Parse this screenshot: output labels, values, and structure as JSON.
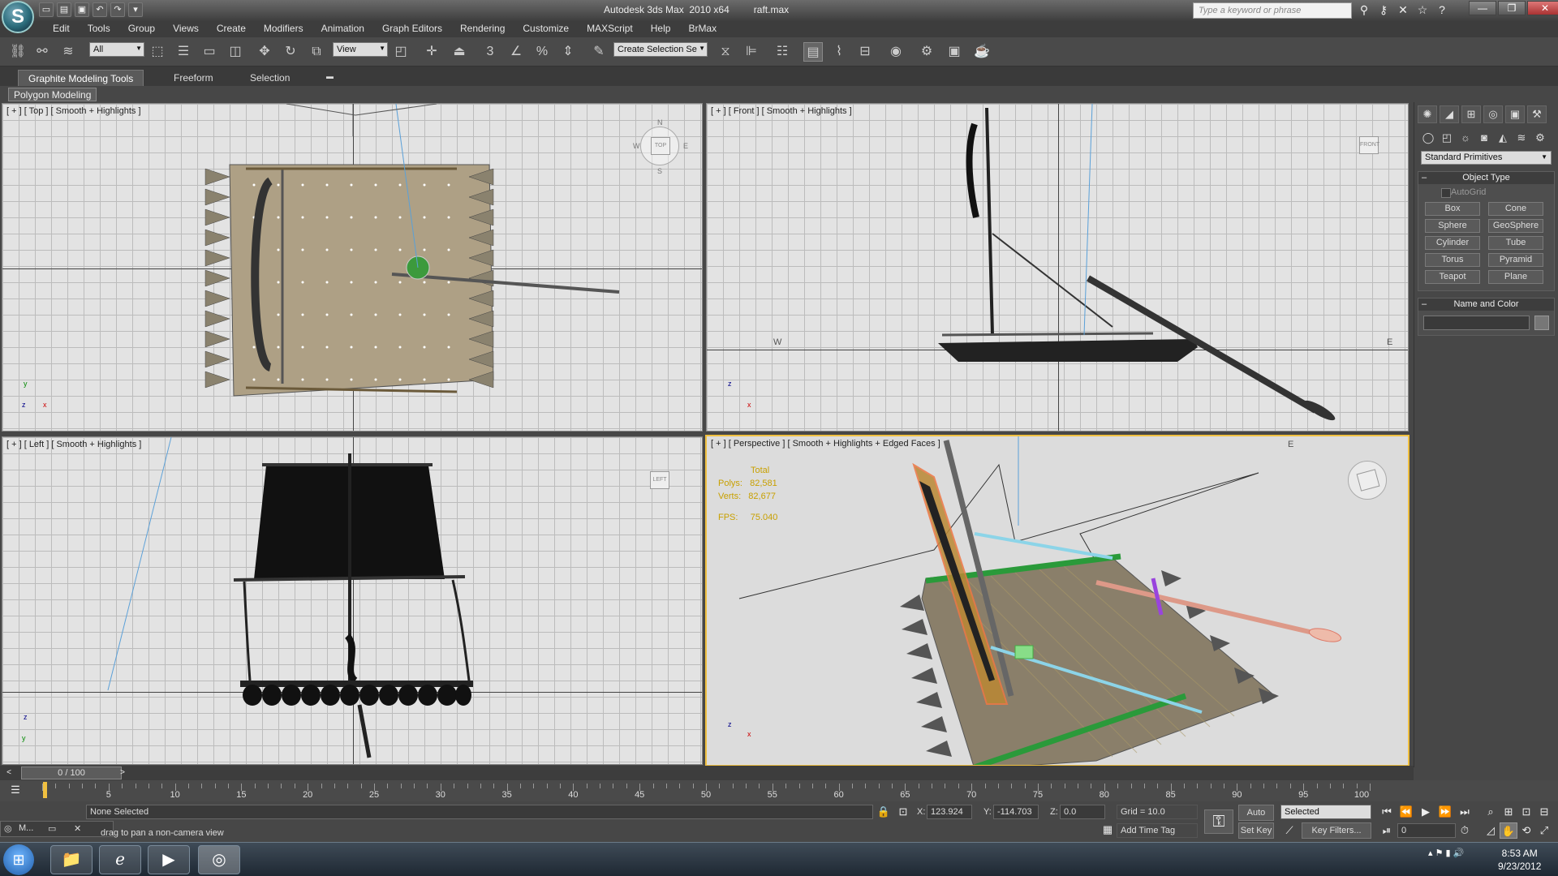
{
  "window": {
    "logo": "S",
    "title": "Autodesk 3ds Max  2010 x64         raft.max",
    "search_placeholder": "Type a keyword or phrase",
    "controls": [
      "—",
      "❐",
      "✕"
    ]
  },
  "menu": [
    "Edit",
    "Tools",
    "Group",
    "Views",
    "Create",
    "Modifiers",
    "Animation",
    "Graph Editors",
    "Rendering",
    "Customize",
    "MAXScript",
    "Help",
    "BrMax"
  ],
  "toolbar": {
    "selection_filter": "All",
    "ref_coord": "View",
    "named_selection": "Create Selection Se",
    "snap_label": "3"
  },
  "ribbon": {
    "tabs": [
      "Graphite Modeling Tools",
      "Freeform",
      "Selection"
    ],
    "panel_label": "Polygon Modeling"
  },
  "viewports": {
    "top": {
      "label": "[ + ] [ Top ] [ Smooth + Highlights ]",
      "cube_face": "TOP",
      "dirs": [
        "N",
        "S",
        "W",
        "E"
      ]
    },
    "front": {
      "label": "[ + ] [ Front ] [ Smooth + Highlights ]",
      "cube_face": "FRONT",
      "markers": [
        "W",
        "E"
      ]
    },
    "left": {
      "label": "[ + ] [ Left ] [ Smooth + Highlights ]",
      "cube_face": "LEFT"
    },
    "perspective": {
      "label": "[ + ] [ Perspective ] [ Smooth + Highlights + Edged Faces ]",
      "stats": {
        "total": "Total",
        "polys": "Polys:   82,581",
        "verts": "Verts:   82,677",
        "fps": "FPS:     75.040"
      },
      "marker": "E"
    }
  },
  "axes": {
    "x": "x",
    "y": "y",
    "z": "z"
  },
  "command_panel": {
    "dropdown": "Standard Primitives",
    "object_type_title": "Object Type",
    "autogrid": "AutoGrid",
    "object_buttons": [
      "Box",
      "Cone",
      "Sphere",
      "GeoSphere",
      "Cylinder",
      "Tube",
      "Torus",
      "Pyramid",
      "Teapot",
      "Plane"
    ],
    "name_color_title": "Name and Color"
  },
  "timeline": {
    "slider": "0 / 100",
    "ticks": [
      "5",
      "10",
      "15",
      "20",
      "25",
      "30",
      "35",
      "40",
      "45",
      "50",
      "55",
      "60",
      "65",
      "70",
      "75",
      "80",
      "85",
      "90",
      "95",
      "100"
    ],
    "current_frame": 0
  },
  "status": {
    "selection": "None Selected",
    "hint": "Click or click-and-drag to pan a non-camera view",
    "hint_visible": "drag to pan a non-camera view",
    "x_label": "X:",
    "x_value": "123.924",
    "y_label": "Y:",
    "y_value": "-114.703",
    "z_label": "Z:",
    "z_value": "0.0",
    "grid": "Grid = 10.0",
    "add_time_tag": "Add Time Tag",
    "auto_key": "Auto Key",
    "set_key": "Set Key",
    "key_mode": "Selected",
    "key_filters": "Key Filters...",
    "frame": "0",
    "mini": "M..."
  },
  "taskbar": {
    "time": "8:53 AM",
    "date": "9/23/2012"
  },
  "colors": {
    "accent": "#f0c040",
    "ui": "#474747",
    "viewport": "#e3e3e3"
  }
}
